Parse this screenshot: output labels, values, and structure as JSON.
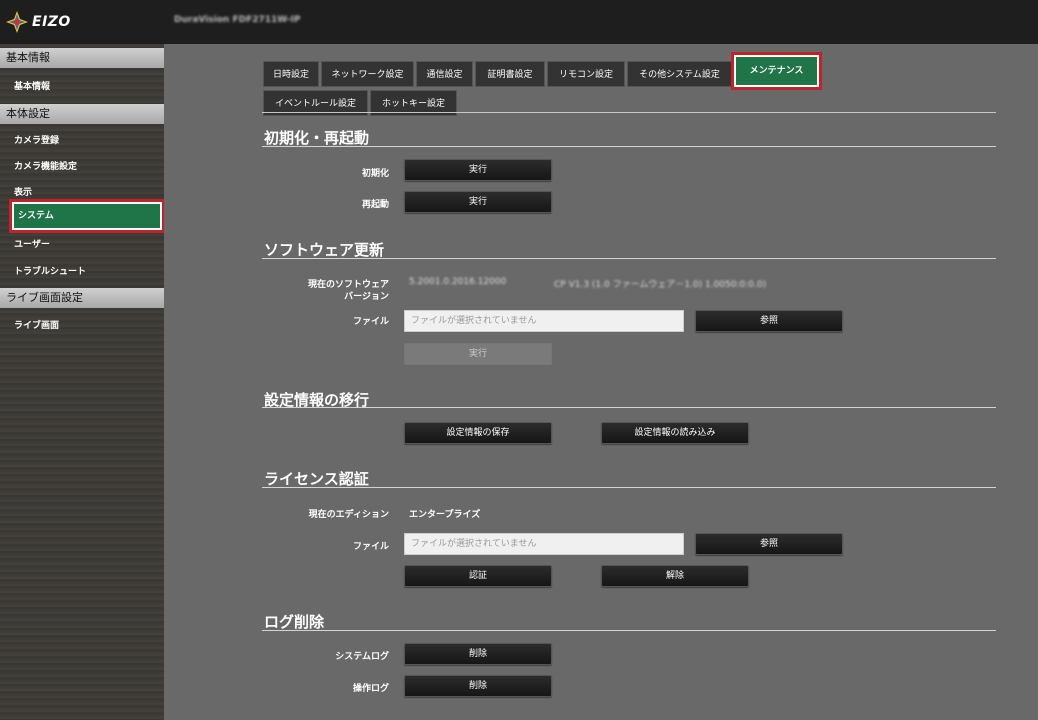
{
  "header": {
    "logo_text": "EIZO",
    "device_name": "DuraVision FDF2711W-IP"
  },
  "sidebar": {
    "sections": [
      {
        "title": "基本情報",
        "items": [
          "基本情報"
        ]
      },
      {
        "title": "本体設定",
        "items": [
          "カメラ登録",
          "カメラ機能設定",
          "表示",
          "システム",
          "ユーザー",
          "トラブルシュート"
        ]
      },
      {
        "title": "ライブ画面設定",
        "items": [
          "ライブ画面"
        ]
      }
    ],
    "active_item": "システム"
  },
  "tabs": {
    "row1": [
      "日時設定",
      "ネットワーク設定",
      "通信設定",
      "証明書設定",
      "リモコン設定",
      "その他システム設定",
      "メンテナンス"
    ],
    "row2": [
      "イベントルール設定",
      "ホットキー設定"
    ],
    "active": "メンテナンス"
  },
  "init": {
    "title": "初期化・再起動",
    "init_label": "初期化",
    "init_button": "実行",
    "reboot_label": "再起動",
    "reboot_button": "実行"
  },
  "software": {
    "title": "ソフトウェア更新",
    "current_label_1": "現在のソフトウェア",
    "current_label_2": "バージョン",
    "version_value": "5.2001.0.2016.12000",
    "version_detail": "CP V1.3 (1.0 ファームウェア－1.0) 1.0050:0:0.0)",
    "file_label": "ファイル",
    "file_placeholder": "ファイルが選択されていません",
    "browse_button": "参照",
    "run_button": "実行"
  },
  "migrate": {
    "title": "設定情報の移行",
    "save_button": "設定情報の保存",
    "load_button": "設定情報の読み込み"
  },
  "license": {
    "title": "ライセンス認証",
    "edition_label": "現在のエディション",
    "edition_value": "エンタープライズ",
    "file_label": "ファイル",
    "file_placeholder": "ファイルが選択されていません",
    "browse_button": "参照",
    "auth_button": "認証",
    "release_button": "解除"
  },
  "logs": {
    "title": "ログ削除",
    "system_label": "システムログ",
    "system_button": "削除",
    "operation_label": "操作ログ",
    "operation_button": "削除"
  }
}
